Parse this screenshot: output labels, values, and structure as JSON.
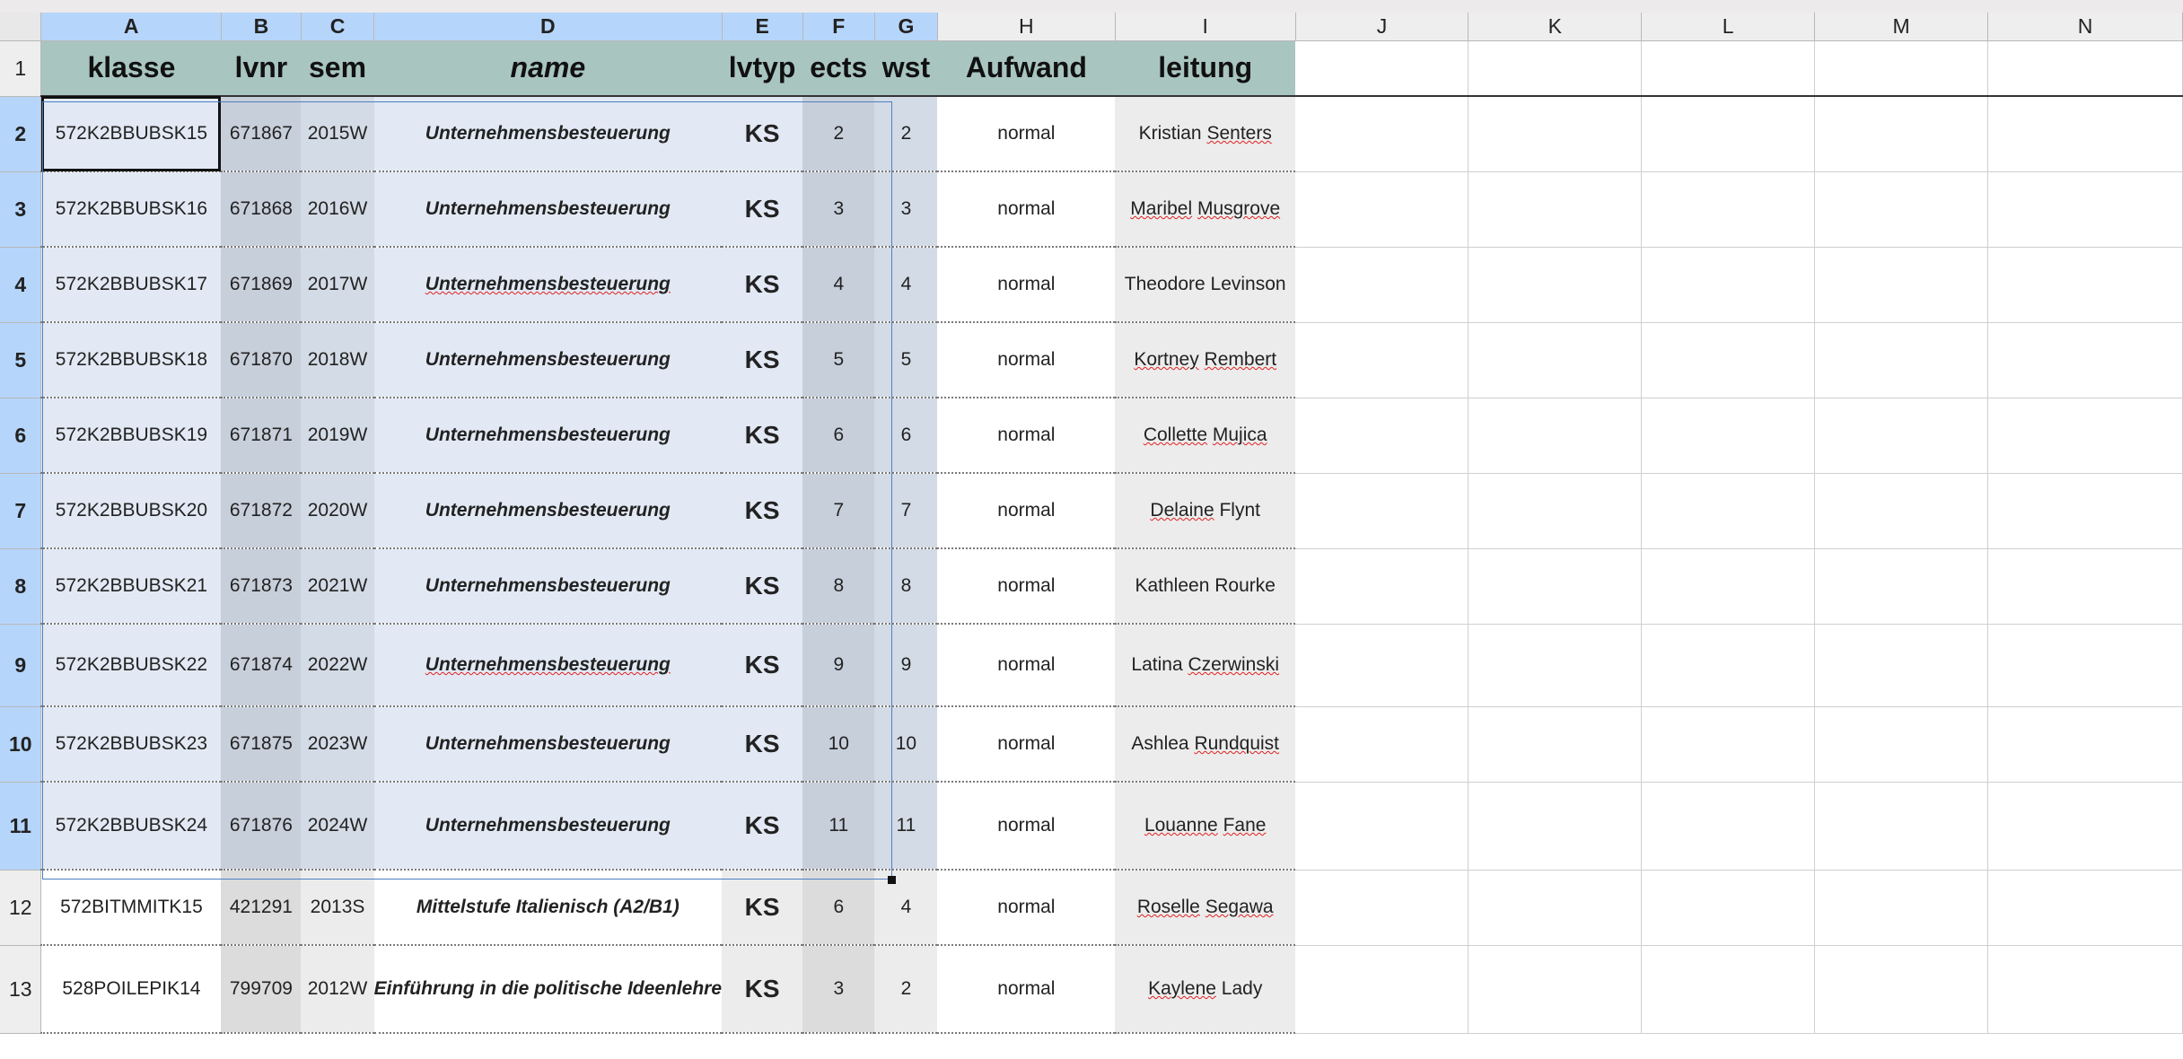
{
  "columns": [
    "A",
    "B",
    "C",
    "D",
    "E",
    "F",
    "G",
    "H",
    "I",
    "J",
    "K",
    "L",
    "M",
    "N"
  ],
  "header_row_number": "1",
  "headers": {
    "klasse": "klasse",
    "lvnr": "lvnr",
    "sem": "sem",
    "name": "name",
    "lvtyp": "lvtyp",
    "ects": "ects",
    "wst": "wst",
    "aufwand": "Aufwand",
    "leitung": "leitung"
  },
  "rows": [
    {
      "num": "2",
      "klasse": "572K2BBUBSK15",
      "lvnr": "671867",
      "sem": "2015W",
      "name": "Unternehmensbesteuerung",
      "lvtyp": "KS",
      "ects": "2",
      "wst": "2",
      "aufwand": "normal",
      "leitung": "Kristian Senters"
    },
    {
      "num": "3",
      "klasse": "572K2BBUBSK16",
      "lvnr": "671868",
      "sem": "2016W",
      "name": "Unternehmensbesteuerung",
      "lvtyp": "KS",
      "ects": "3",
      "wst": "3",
      "aufwand": "normal",
      "leitung": "Maribel Musgrove"
    },
    {
      "num": "4",
      "klasse": "572K2BBUBSK17",
      "lvnr": "671869",
      "sem": "2017W",
      "name": "Unternehmensbesteuerung",
      "lvtyp": "KS",
      "ects": "4",
      "wst": "4",
      "aufwand": "normal",
      "leitung": "Theodore Levinson"
    },
    {
      "num": "5",
      "klasse": "572K2BBUBSK18",
      "lvnr": "671870",
      "sem": "2018W",
      "name": "Unternehmensbesteuerung",
      "lvtyp": "KS",
      "ects": "5",
      "wst": "5",
      "aufwand": "normal",
      "leitung": "Kortney Rembert"
    },
    {
      "num": "6",
      "klasse": "572K2BBUBSK19",
      "lvnr": "671871",
      "sem": "2019W",
      "name": "Unternehmensbesteuerung",
      "lvtyp": "KS",
      "ects": "6",
      "wst": "6",
      "aufwand": "normal",
      "leitung": "Collette Mujica"
    },
    {
      "num": "7",
      "klasse": "572K2BBUBSK20",
      "lvnr": "671872",
      "sem": "2020W",
      "name": "Unternehmensbesteuerung",
      "lvtyp": "KS",
      "ects": "7",
      "wst": "7",
      "aufwand": "normal",
      "leitung": "Delaine Flynt"
    },
    {
      "num": "8",
      "klasse": "572K2BBUBSK21",
      "lvnr": "671873",
      "sem": "2021W",
      "name": "Unternehmensbesteuerung",
      "lvtyp": "KS",
      "ects": "8",
      "wst": "8",
      "aufwand": "normal",
      "leitung": "Kathleen Rourke"
    },
    {
      "num": "9",
      "klasse": "572K2BBUBSK22",
      "lvnr": "671874",
      "sem": "2022W",
      "name": "Unternehmensbesteuerung",
      "lvtyp": "KS",
      "ects": "9",
      "wst": "9",
      "aufwand": "normal",
      "leitung": "Latina Czerwinski"
    },
    {
      "num": "10",
      "klasse": "572K2BBUBSK23",
      "lvnr": "671875",
      "sem": "2023W",
      "name": "Unternehmensbesteuerung",
      "lvtyp": "KS",
      "ects": "10",
      "wst": "10",
      "aufwand": "normal",
      "leitung": "Ashlea Rundquist"
    },
    {
      "num": "11",
      "klasse": "572K2BBUBSK24",
      "lvnr": "671876",
      "sem": "2024W",
      "name": "Unternehmensbesteuerung",
      "lvtyp": "KS",
      "ects": "11",
      "wst": "11",
      "aufwand": "normal",
      "leitung": "Louanne Fane"
    },
    {
      "num": "12",
      "klasse": "572BITMMITK15",
      "lvnr": "421291",
      "sem": "2013S",
      "name": "Mittelstufe Italienisch (A2/B1)",
      "lvtyp": "KS",
      "ects": "6",
      "wst": "4",
      "aufwand": "normal",
      "leitung": "Roselle Segawa"
    },
    {
      "num": "13",
      "klasse": "528POILEPIK14",
      "lvnr": "799709",
      "sem": "2012W",
      "name": "Einführung in die politische Ideenlehre",
      "lvtyp": "KS",
      "ects": "3",
      "wst": "2",
      "aufwand": "normal",
      "leitung": "Kaylene Lady"
    }
  ]
}
